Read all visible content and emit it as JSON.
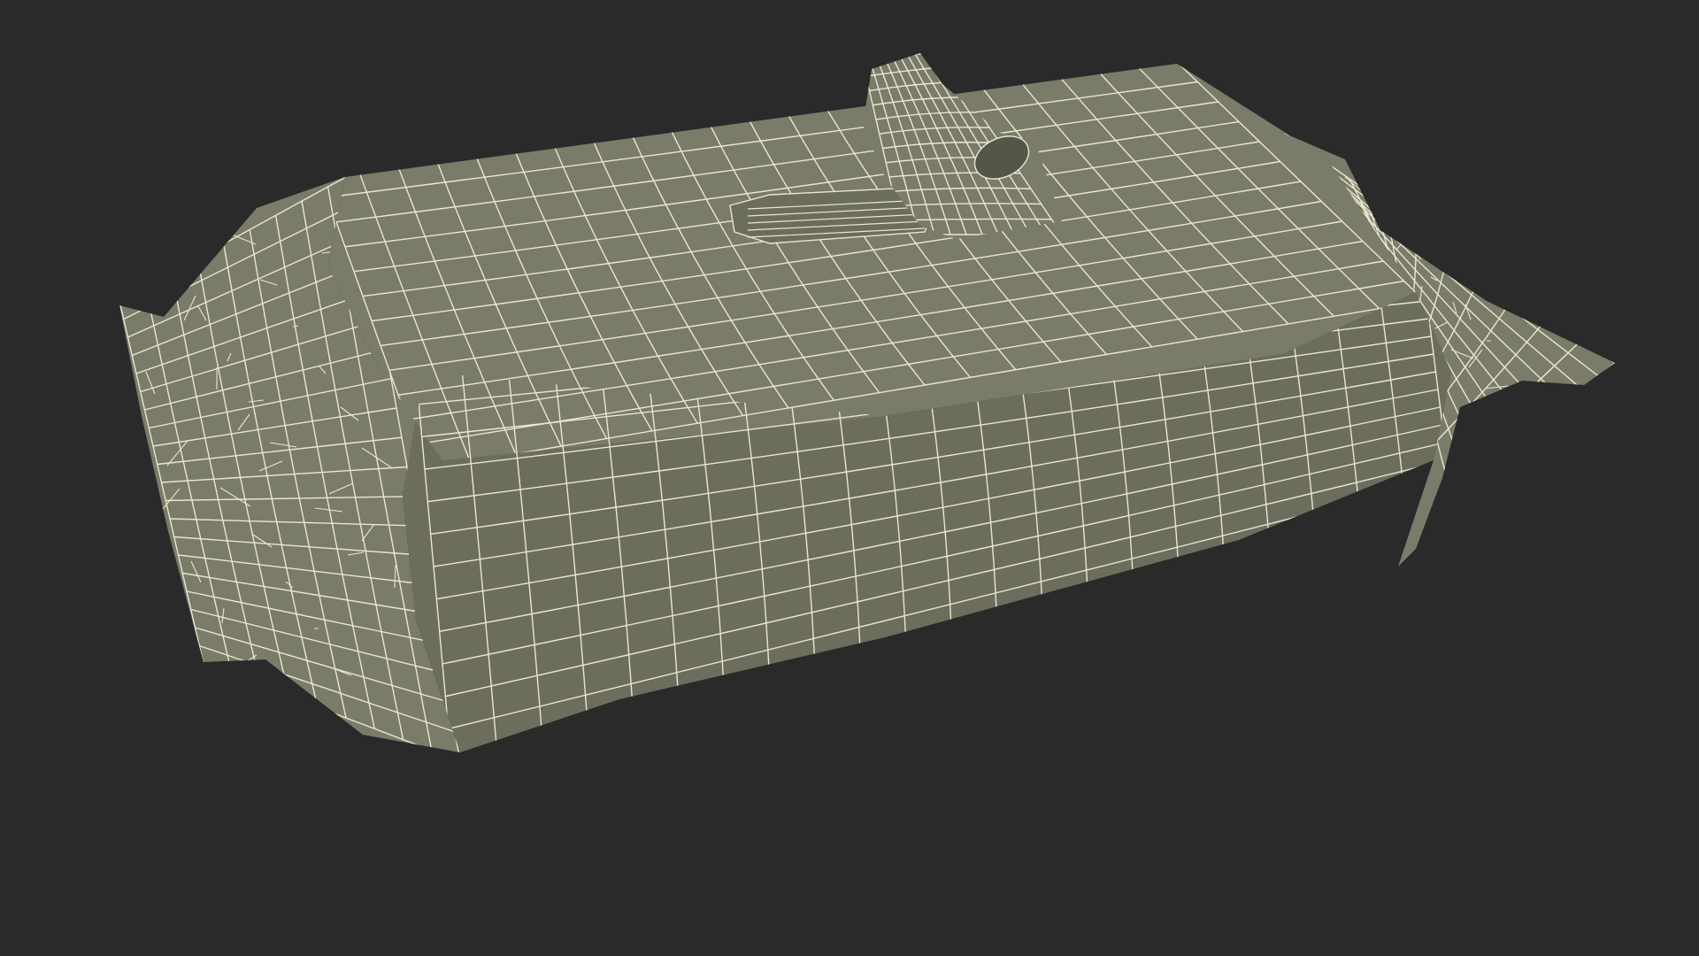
{
  "scene": {
    "subject": "wet-wipes-pack-wireframe",
    "colors": {
      "background": "#2a2a2a",
      "surface": "#7a7b68",
      "surface_shade": "#6c6d5c",
      "surface_dark": "#55564a",
      "wire": "#e9e7d2"
    }
  }
}
